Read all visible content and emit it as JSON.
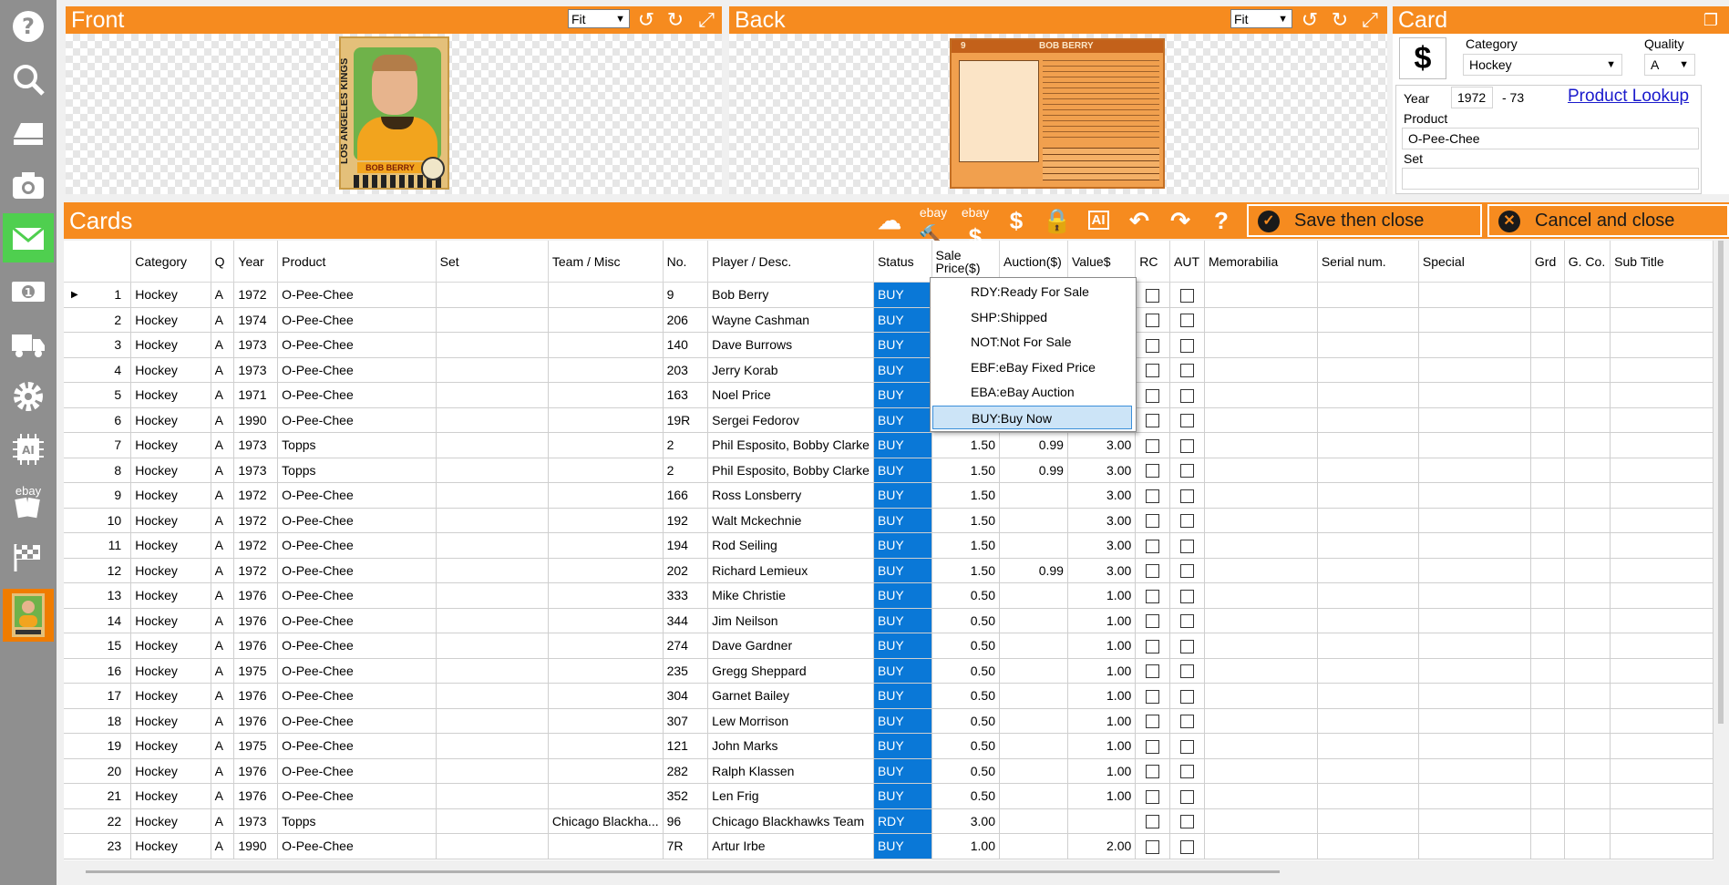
{
  "front_panel": {
    "title": "Front",
    "fit": "Fit"
  },
  "back_panel": {
    "title": "Back",
    "fit": "Fit"
  },
  "card_images": {
    "front_team": "LOS ANGELES KINGS",
    "front_name": "BOB BERRY",
    "back_number": "9",
    "back_name": "BOB BERRY"
  },
  "card_panel": {
    "title": "Card",
    "category_label": "Category",
    "category_value": "Hockey",
    "quality_label": "Quality",
    "quality_value": "A",
    "year_label": "Year",
    "year_value": "1972",
    "year_suffix": "- 73",
    "product_lookup": "Product Lookup",
    "product_label": "Product",
    "product_value": "O-Pee-Chee",
    "set_label": "Set",
    "set_value": ""
  },
  "cards_toolbar": {
    "title": "Cards",
    "save_label": "Save then close",
    "cancel_label": "Cancel and close",
    "ebay_text": "ebay",
    "dollar_text": "$",
    "ai_text": "AI"
  },
  "sidebar_ebay_text": "ebay",
  "grid": {
    "columns": [
      "",
      "Category",
      "Q",
      "Year",
      "Product",
      "Set",
      "Team / Misc",
      "No.",
      "Player / Desc.",
      "Status",
      "Sale Price($)",
      "Auction($)",
      "Value$",
      "RC",
      "AUT",
      "Memorabilia",
      "Serial num.",
      "Special",
      "Grd",
      "G. Co.",
      "Sub Title"
    ],
    "rows": [
      [
        "1",
        "Hockey",
        "A",
        "1972",
        "O-Pee-Chee",
        "",
        "",
        "9",
        "Bob Berry",
        "BUY",
        "",
        "",
        "",
        "",
        "",
        "",
        "",
        "",
        "",
        "",
        ""
      ],
      [
        "2",
        "Hockey",
        "A",
        "1974",
        "O-Pee-Chee",
        "",
        "",
        "206",
        "Wayne Cashman",
        "BUY",
        "",
        "",
        "",
        "",
        "",
        "",
        "",
        "",
        "",
        "",
        ""
      ],
      [
        "3",
        "Hockey",
        "A",
        "1973",
        "O-Pee-Chee",
        "",
        "",
        "140",
        "Dave Burrows",
        "BUY",
        "",
        "",
        "",
        "",
        "",
        "",
        "",
        "",
        "",
        "",
        ""
      ],
      [
        "4",
        "Hockey",
        "A",
        "1973",
        "O-Pee-Chee",
        "",
        "",
        "203",
        "Jerry Korab",
        "BUY",
        "",
        "",
        "",
        "",
        "",
        "",
        "",
        "",
        "",
        "",
        ""
      ],
      [
        "5",
        "Hockey",
        "A",
        "1971",
        "O-Pee-Chee",
        "",
        "",
        "163",
        "Noel Price",
        "BUY",
        "",
        "",
        "",
        "",
        "",
        "",
        "",
        "",
        "",
        "",
        ""
      ],
      [
        "6",
        "Hockey",
        "A",
        "1990",
        "O-Pee-Chee",
        "",
        "",
        "19R",
        "Sergei Fedorov",
        "BUY",
        "",
        "",
        "",
        "",
        "",
        "",
        "",
        "",
        "",
        "",
        ""
      ],
      [
        "7",
        "Hockey",
        "A",
        "1973",
        "Topps",
        "",
        "",
        "2",
        "Phil Esposito, Bobby Clarke",
        "BUY",
        "1.50",
        "0.99",
        "3.00",
        "",
        "",
        "",
        "",
        "",
        "",
        "",
        ""
      ],
      [
        "8",
        "Hockey",
        "A",
        "1973",
        "Topps",
        "",
        "",
        "2",
        "Phil Esposito, Bobby Clarke",
        "BUY",
        "1.50",
        "0.99",
        "3.00",
        "",
        "",
        "",
        "",
        "",
        "",
        "",
        ""
      ],
      [
        "9",
        "Hockey",
        "A",
        "1972",
        "O-Pee-Chee",
        "",
        "",
        "166",
        "Ross Lonsberry",
        "BUY",
        "1.50",
        "",
        "3.00",
        "",
        "",
        "",
        "",
        "",
        "",
        "",
        ""
      ],
      [
        "10",
        "Hockey",
        "A",
        "1972",
        "O-Pee-Chee",
        "",
        "",
        "192",
        "Walt Mckechnie",
        "BUY",
        "1.50",
        "",
        "3.00",
        "",
        "",
        "",
        "",
        "",
        "",
        "",
        ""
      ],
      [
        "11",
        "Hockey",
        "A",
        "1972",
        "O-Pee-Chee",
        "",
        "",
        "194",
        "Rod Seiling",
        "BUY",
        "1.50",
        "",
        "3.00",
        "",
        "",
        "",
        "",
        "",
        "",
        "",
        ""
      ],
      [
        "12",
        "Hockey",
        "A",
        "1972",
        "O-Pee-Chee",
        "",
        "",
        "202",
        "Richard Lemieux",
        "BUY",
        "1.50",
        "0.99",
        "3.00",
        "",
        "",
        "",
        "",
        "",
        "",
        "",
        ""
      ],
      [
        "13",
        "Hockey",
        "A",
        "1976",
        "O-Pee-Chee",
        "",
        "",
        "333",
        "Mike Christie",
        "BUY",
        "0.50",
        "",
        "1.00",
        "",
        "",
        "",
        "",
        "",
        "",
        "",
        ""
      ],
      [
        "14",
        "Hockey",
        "A",
        "1976",
        "O-Pee-Chee",
        "",
        "",
        "344",
        "Jim Neilson",
        "BUY",
        "0.50",
        "",
        "1.00",
        "",
        "",
        "",
        "",
        "",
        "",
        "",
        ""
      ],
      [
        "15",
        "Hockey",
        "A",
        "1976",
        "O-Pee-Chee",
        "",
        "",
        "274",
        "Dave Gardner",
        "BUY",
        "0.50",
        "",
        "1.00",
        "",
        "",
        "",
        "",
        "",
        "",
        "",
        ""
      ],
      [
        "16",
        "Hockey",
        "A",
        "1975",
        "O-Pee-Chee",
        "",
        "",
        "235",
        "Gregg Sheppard",
        "BUY",
        "0.50",
        "",
        "1.00",
        "",
        "",
        "",
        "",
        "",
        "",
        "",
        ""
      ],
      [
        "17",
        "Hockey",
        "A",
        "1976",
        "O-Pee-Chee",
        "",
        "",
        "304",
        "Garnet Bailey",
        "BUY",
        "0.50",
        "",
        "1.00",
        "",
        "",
        "",
        "",
        "",
        "",
        "",
        ""
      ],
      [
        "18",
        "Hockey",
        "A",
        "1976",
        "O-Pee-Chee",
        "",
        "",
        "307",
        "Lew Morrison",
        "BUY",
        "0.50",
        "",
        "1.00",
        "",
        "",
        "",
        "",
        "",
        "",
        "",
        ""
      ],
      [
        "19",
        "Hockey",
        "A",
        "1975",
        "O-Pee-Chee",
        "",
        "",
        "121",
        "John Marks",
        "BUY",
        "0.50",
        "",
        "1.00",
        "",
        "",
        "",
        "",
        "",
        "",
        "",
        ""
      ],
      [
        "20",
        "Hockey",
        "A",
        "1976",
        "O-Pee-Chee",
        "",
        "",
        "282",
        "Ralph Klassen",
        "BUY",
        "0.50",
        "",
        "1.00",
        "",
        "",
        "",
        "",
        "",
        "",
        "",
        ""
      ],
      [
        "21",
        "Hockey",
        "A",
        "1976",
        "O-Pee-Chee",
        "",
        "",
        "352",
        "Len Frig",
        "BUY",
        "0.50",
        "",
        "1.00",
        "",
        "",
        "",
        "",
        "",
        "",
        "",
        ""
      ],
      [
        "22",
        "Hockey",
        "A",
        "1973",
        "Topps",
        "",
        "Chicago Blackha...",
        "96",
        "Chicago Blackhawks Team",
        "RDY",
        "3.00",
        "",
        "",
        "",
        "",
        "",
        "",
        "",
        "",
        "",
        ""
      ],
      [
        "23",
        "Hockey",
        "A",
        "1990",
        "O-Pee-Chee",
        "",
        "",
        "7R",
        "Artur Irbe",
        "BUY",
        "1.00",
        "",
        "2.00",
        "",
        "",
        "",
        "",
        "",
        "",
        "",
        ""
      ]
    ]
  },
  "status_dropdown": {
    "options": [
      "RDY:Ready For Sale",
      "SHP:Shipped",
      "NOT:Not For Sale",
      "EBF:eBay Fixed Price",
      "EBA:eBay Auction",
      "BUY:Buy Now"
    ],
    "selected": "BUY:Buy Now"
  },
  "colors": {
    "accent_orange": "#f68b1f",
    "status_blue": "#0a78d7",
    "sidebar_gray": "#8f8f8f",
    "active_green": "#4fcf4f",
    "link_blue": "#1a1acc"
  }
}
